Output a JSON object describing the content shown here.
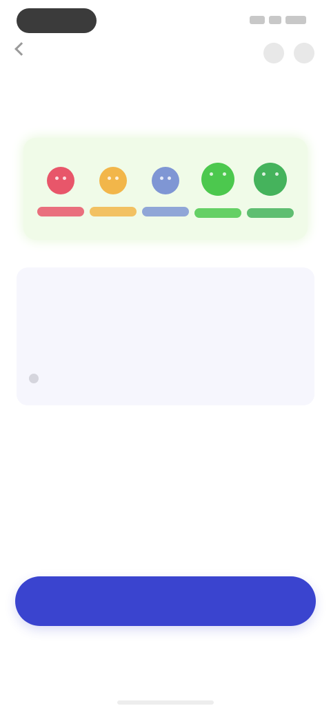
{
  "status_bar": {
    "time": ""
  },
  "header": {
    "title": ""
  },
  "mood_section": {
    "caption": "",
    "title": "",
    "moods": [
      {
        "label": "",
        "color": "#e8566a"
      },
      {
        "label": "",
        "color": "#f2b64a"
      },
      {
        "label": "",
        "color": "#7f96d4"
      },
      {
        "label": "",
        "color": "#4cc84e"
      },
      {
        "label": "",
        "color": "#45b35c"
      }
    ]
  },
  "result": {
    "caption": "",
    "headline": "",
    "subtitle": "",
    "meta": ""
  },
  "actions": {
    "primary_label": "",
    "secondary_label": ""
  },
  "colors": {
    "accent": "#3a44cf",
    "card_green": "#f0fbe8",
    "card_lavender": "#f6f6fd"
  }
}
